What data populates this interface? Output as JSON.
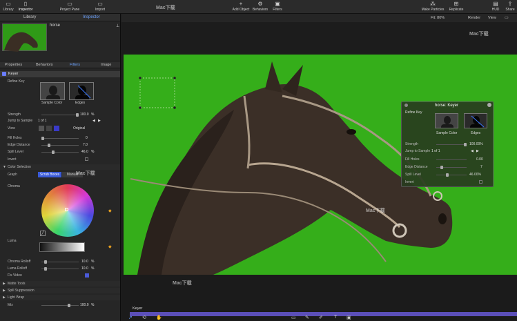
{
  "toolbar": {
    "library": "Library",
    "inspector": "Inspector",
    "project_pane": "Project Pane",
    "import": "Import",
    "add_object": "Add Object",
    "behaviors": "Behaviors",
    "filters": "Filters",
    "make_particles": "Make Particles",
    "replicate": "Replicate",
    "hud": "HUD",
    "share": "Share"
  },
  "panel": {
    "tab_library": "Library",
    "tab_inspector": "Inspector",
    "object_name": "horse",
    "tabs": [
      "Properties",
      "Behaviors",
      "Filters",
      "Image"
    ],
    "keyer_title": "Keyer",
    "refine_key": "Refine Key",
    "sample_color": "Sample Color",
    "edges": "Edges",
    "strength": {
      "label": "Strength",
      "value": "100.0",
      "unit": "%"
    },
    "jump_to_sample": {
      "label": "Jump to Sample",
      "value": "1 of 1"
    },
    "view": {
      "label": "View",
      "value": "Original"
    },
    "fill_holes": {
      "label": "Fill Holes",
      "value": "0"
    },
    "edge_distance": {
      "label": "Edge Distance",
      "value": "7.0"
    },
    "spill_level": {
      "label": "Spill Level",
      "value": "46.0",
      "unit": "%"
    },
    "invert": "Invert",
    "color_selection": "Color Selection",
    "graph": "Graph",
    "scrub_boxes": "Scrub Boxes",
    "manual": "Manual",
    "chroma": "Chroma",
    "luma": "Luma",
    "chroma_rolloff": {
      "label": "Chroma Rolloff",
      "value": "10.0",
      "unit": "%"
    },
    "luma_rolloff": {
      "label": "Luma Rolloff",
      "value": "10.0",
      "unit": "%"
    },
    "fix_video": "Fix Video",
    "matte_tools": "Matte Tools",
    "spill_suppression": "Spill Suppression",
    "light_wrap": "Light Wrap",
    "mix": {
      "label": "Mix",
      "value": "100.0",
      "unit": "%"
    }
  },
  "viewer": {
    "fit": "Fit: 80%",
    "render": "Render",
    "view": "View",
    "layer_label": "Keyer"
  },
  "hud": {
    "title": "horse: Keyer",
    "refine_key": "Refine Key",
    "sample_color": "Sample Color",
    "edges": "Edges",
    "strength": {
      "label": "Strength",
      "value": "100.00%"
    },
    "jump_to_sample": {
      "label": "Jump to Sample",
      "value": "1 of 1"
    },
    "fill_holes": {
      "label": "Fill Holes",
      "value": "0.00"
    },
    "edge_distance": {
      "label": "Edge Distance",
      "value": "7"
    },
    "spill_level": {
      "label": "Spill Level",
      "value": "46.00%"
    },
    "invert": "Invert"
  },
  "watermark": "Mac下载",
  "colors": {
    "green_screen": "#35ae1a",
    "accent": "#6da3ff",
    "timeline": "#5b4fb8"
  }
}
